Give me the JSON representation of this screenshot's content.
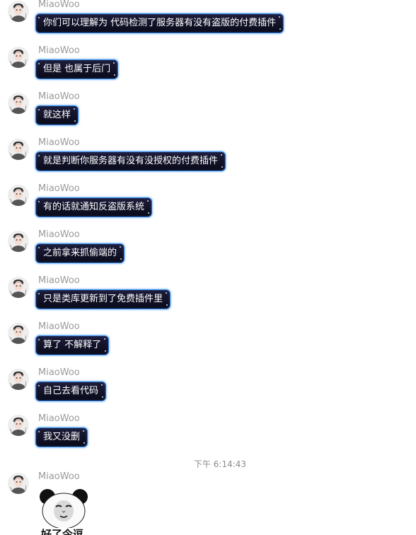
{
  "chat": {
    "messages": [
      {
        "sender": "MiaoWoo",
        "text": "你们可以理解为 代码检测了服务器有没有盗版的付费插件"
      },
      {
        "sender": "MiaoWoo",
        "text": "但是 也属于后门"
      },
      {
        "sender": "MiaoWoo",
        "text": "就这样"
      },
      {
        "sender": "MiaoWoo",
        "text": "就是判断你服务器有没有没授权的付费插件"
      },
      {
        "sender": "MiaoWoo",
        "text": "有的话就通知反盗版系统"
      },
      {
        "sender": "MiaoWoo",
        "text": "之前拿来抓偷端的"
      },
      {
        "sender": "MiaoWoo",
        "text": "只是类库更新到了免费插件里"
      },
      {
        "sender": "MiaoWoo",
        "text": "算了 不解释了"
      },
      {
        "sender": "MiaoWoo",
        "text": "自己去看代码"
      },
      {
        "sender": "MiaoWoo",
        "text": "我又没删"
      }
    ],
    "timestamp": "下午 6:14:43",
    "last": {
      "sender": "MiaoWoo",
      "sticker_caption": "好了今逗"
    }
  },
  "colors": {
    "bubble_bg": "#12122a",
    "bubble_border": "#2d7fd9",
    "sender_text": "#9a9a9a",
    "timestamp_text": "#8c8c8c"
  },
  "icons": {
    "avatar": "user-avatar-icon",
    "sticker": "panda-face-sticker"
  }
}
